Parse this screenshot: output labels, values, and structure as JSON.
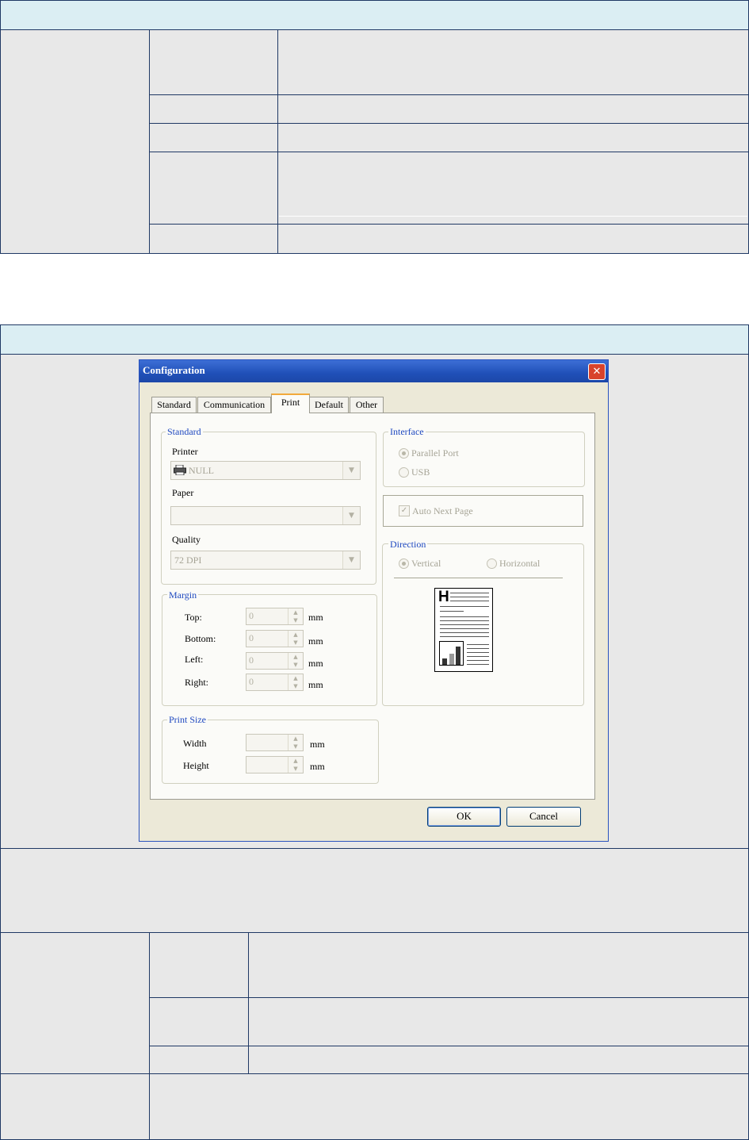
{
  "dialog": {
    "title": "Configuration",
    "close_icon": "close-icon",
    "tabs": [
      {
        "label": "Standard",
        "active": false
      },
      {
        "label": "Communication",
        "active": false
      },
      {
        "label": "Print",
        "active": true
      },
      {
        "label": "Default",
        "active": false
      },
      {
        "label": "Other",
        "active": false
      }
    ],
    "standard_group": {
      "title": "Standard",
      "printer_label": "Printer",
      "printer_value": "NULL",
      "printer_icon": "printer-icon",
      "paper_label": "Paper",
      "paper_value": "",
      "quality_label": "Quality",
      "quality_value": "72 DPI"
    },
    "margin_group": {
      "title": "Margin",
      "top_label": "Top:",
      "top_value": "0",
      "bottom_label": "Bottom:",
      "bottom_value": "0",
      "left_label": "Left:",
      "left_value": "0",
      "right_label": "Right:",
      "right_value": "0",
      "unit": "mm"
    },
    "print_size_group": {
      "title": "Print Size",
      "width_label": "Width",
      "width_value": "",
      "height_label": "Height",
      "height_value": "",
      "unit": "mm"
    },
    "interface_group": {
      "title": "Interface",
      "parallel_label": "Parallel Port",
      "usb_label": "USB",
      "selected": "Parallel Port"
    },
    "auto_next_page": {
      "label": "Auto Next Page",
      "checked": true
    },
    "direction_group": {
      "title": "Direction",
      "vertical_label": "Vertical",
      "horizontal_label": "Horizontal",
      "selected": "Vertical",
      "preview_letter": "H"
    },
    "ok_label": "OK",
    "cancel_label": "Cancel"
  }
}
